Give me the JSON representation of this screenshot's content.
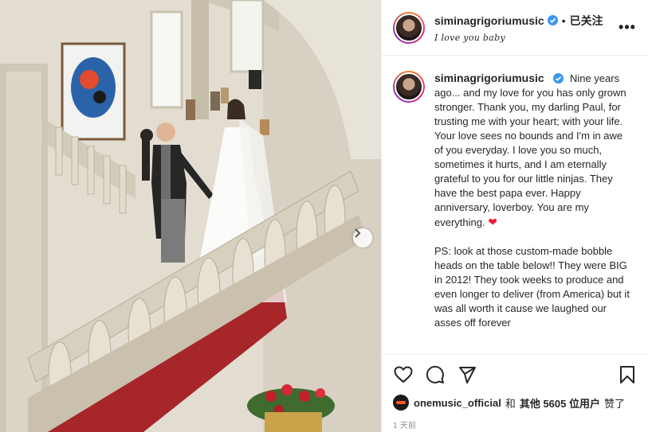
{
  "post": {
    "username": "siminagrigoriumusic",
    "follow_state": "已关注",
    "separator": "•",
    "subtitle": "I love you baby",
    "caption_main": "Nine years ago... and my love for you has only grown stronger. Thank you, my darling Paul, for trusting me with your heart; with your life. Your love sees no bounds and I'm in awe of you everyday. I love you so much, sometimes it hurts, and I am eternally grateful to you for our little ninjas. They have the best papa ever. Happy anniversary, loverboy. You are my everything.",
    "caption_emoji": "❤",
    "caption_ps": "PS: look at those custom-made bobble heads on the table below!! They were BIG in 2012! They took weeks to produce and even longer to deliver (from America) but it was all worth it cause we laughed our asses off forever",
    "liked_by_user": "onemusic_official",
    "liked_by_text_and": "和",
    "liked_by_text_others": "其他 5605 位用户",
    "liked_by_text_suffix": "赞了",
    "timestamp": "1 天前"
  },
  "icons": {
    "verified": "verified-badge-icon",
    "more": "more-options-icon",
    "like": "heart-icon",
    "comment": "comment-icon",
    "share": "share-icon",
    "save": "bookmark-icon",
    "next": "chevron-right-icon"
  },
  "colors": {
    "verified_blue": "#3897f0",
    "heart_red": "#ed1c3c",
    "text": "#262626",
    "muted": "#8e8e8e"
  }
}
